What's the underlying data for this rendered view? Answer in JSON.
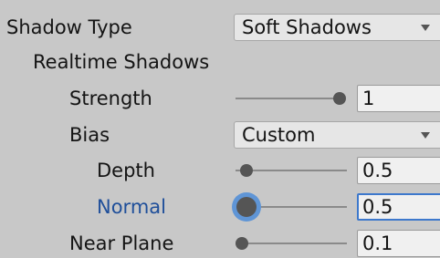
{
  "shadow_type": {
    "label": "Shadow Type",
    "value": "Soft Shadows"
  },
  "realtime_shadows": {
    "heading": "Realtime Shadows"
  },
  "strength": {
    "label": "Strength",
    "value": "1",
    "slider_fraction": 1.0
  },
  "bias": {
    "label": "Bias",
    "value": "Custom"
  },
  "depth": {
    "label": "Depth",
    "value": "0.5",
    "slider_fraction": 0.1
  },
  "normal": {
    "label": "Normal",
    "value": "0.5",
    "slider_fraction": 0.1
  },
  "near_plane": {
    "label": "Near Plane",
    "value": "0.1",
    "slider_fraction": 0.06
  },
  "colors": {
    "background": "#c8c8c8",
    "active_label": "#1f4f9a",
    "focus_ring": "#5f95d6",
    "focus_border": "#3d78cc"
  }
}
